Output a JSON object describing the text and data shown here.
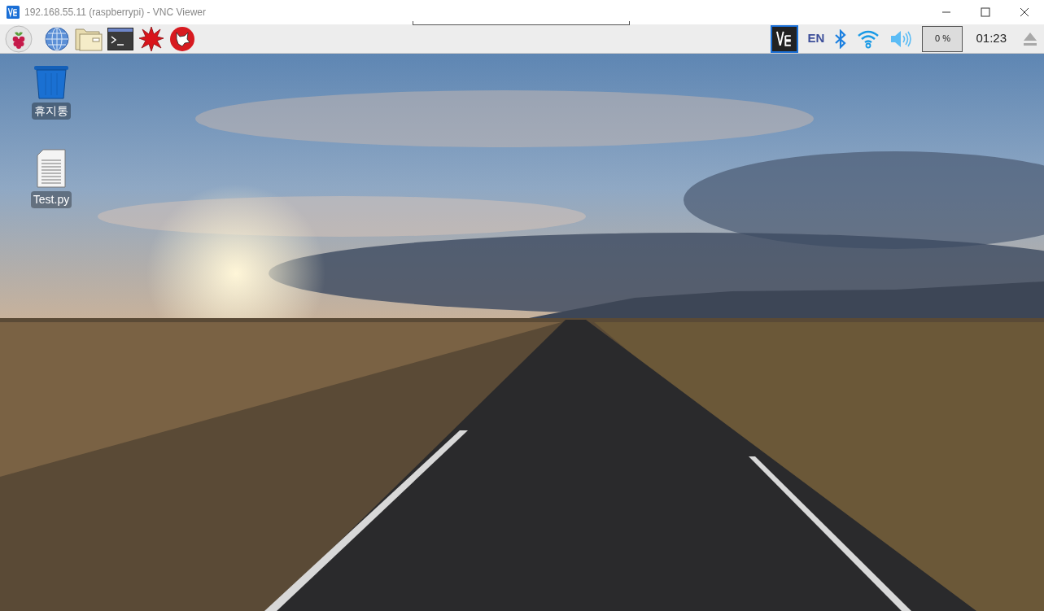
{
  "window": {
    "title": "192.168.55.11 (raspberrypi) - VNC Viewer"
  },
  "taskbar": {
    "language": "EN",
    "cpu": "0 %",
    "clock": "01:23"
  },
  "desktop": {
    "icons": [
      {
        "kind": "trash",
        "label": "휴지통"
      },
      {
        "kind": "file",
        "label": "Test.py"
      }
    ]
  }
}
